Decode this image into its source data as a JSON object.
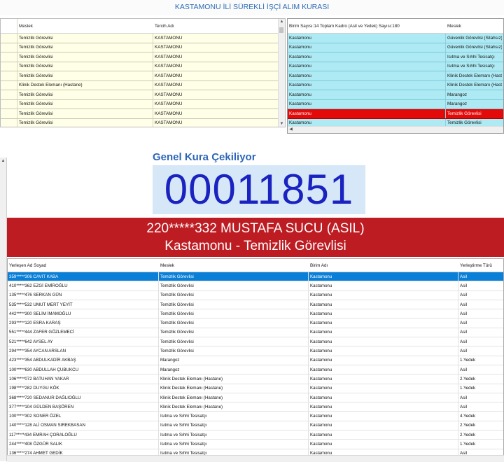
{
  "app": {
    "title": "KASTAMONU İLİ SÜREKLİ İŞÇİ ALIM KURASI"
  },
  "left_grid": {
    "columns": [
      "Meslek",
      "Tercih Adı"
    ],
    "rows": [
      [
        "Temizlik Görevlisi",
        "KASTAMONU"
      ],
      [
        "Temizlik Görevlisi",
        "KASTAMONU"
      ],
      [
        "Temizlik Görevlisi",
        "KASTAMONU"
      ],
      [
        "Temizlik Görevlisi",
        "KASTAMONU"
      ],
      [
        "Temizlik Görevlisi",
        "KASTAMONU"
      ],
      [
        "Klinik Destek Elemanı (Hastane)",
        "KASTAMONU"
      ],
      [
        "Temizlik Görevlisi",
        "KASTAMONU"
      ],
      [
        "Temizlik Görevlisi",
        "KASTAMONU"
      ],
      [
        "Temizlik Görevlisi",
        "KASTAMONU"
      ],
      [
        "Temizlik Görevlisi",
        "KASTAMONU"
      ]
    ]
  },
  "right_grid": {
    "columns": [
      "Birim Sayısı:14 Toplam Kadro (Asil ve Yedek) Sayısı:180",
      "Meslek"
    ],
    "rows": [
      {
        "cells": [
          "Kastamonu",
          "Güvenlik Görevlisi (Silahsız)"
        ],
        "highlight": false
      },
      {
        "cells": [
          "Kastamonu",
          "Güvenlik Görevlisi (Silahsız)"
        ],
        "highlight": false
      },
      {
        "cells": [
          "Kastamonu",
          "Isıtma ve Sıhhi Tesisatçı"
        ],
        "highlight": false
      },
      {
        "cells": [
          "Kastamonu",
          "Isıtma ve Sıhhi Tesisatçı"
        ],
        "highlight": false
      },
      {
        "cells": [
          "Kastamonu",
          "Klinik Destek Elemanı (Hastane)"
        ],
        "highlight": false
      },
      {
        "cells": [
          "Kastamonu",
          "Klinik Destek Elemanı (Hastane)"
        ],
        "highlight": false
      },
      {
        "cells": [
          "Kastamonu",
          "Marangoz"
        ],
        "highlight": false
      },
      {
        "cells": [
          "Kastamonu",
          "Marangoz"
        ],
        "highlight": false
      },
      {
        "cells": [
          "Kastamonu",
          "Temizlik Görevlisi"
        ],
        "highlight": true
      },
      {
        "cells": [
          "Kastamonu",
          "Temizlik Görevlisi"
        ],
        "highlight": false
      }
    ],
    "colors": {
      "row": "#aeeaf4",
      "highlight": "#e30a0a"
    }
  },
  "draw": {
    "heading": "Genel Kura Çekiliyor",
    "number": "00011851",
    "winner_name": "220*****332 MUSTAFA SUCU (ASIL)",
    "winner_detail": "Kastamonu - Temizlik Görevlisi"
  },
  "bottom_grid": {
    "columns": [
      "Yerleşen Ad Soyad",
      "Meslek",
      "Birim Adı",
      "Yerleştirme Türü"
    ],
    "rows": [
      [
        "359*****306 CAVIT KABA",
        "Temizlik Görevlisi",
        "Kastamonu",
        "Asil"
      ],
      [
        "410*****362 EZGİ EMİROĞLU",
        "Temizlik Görevlisi",
        "Kastamonu",
        "Asil"
      ],
      [
        "135*****476 SERKAN GÜN",
        "Temizlik Görevlisi",
        "Kastamonu",
        "Asil"
      ],
      [
        "535*****532 UMUT MERT YEYİT",
        "Temizlik Görevlisi",
        "Kastamonu",
        "Asil"
      ],
      [
        "442*****300 SELİM İMAMOĞLU",
        "Temizlik Görevlisi",
        "Kastamonu",
        "Asil"
      ],
      [
        "293*****120 ESRA KARAŞ",
        "Temizlik Görevlisi",
        "Kastamonu",
        "Asil"
      ],
      [
        "551*****444 ZAFER GÖZLEMECİ",
        "Temizlik Görevlisi",
        "Kastamonu",
        "Asil"
      ],
      [
        "521*****642 AYSEL AY",
        "Temizlik Görevlisi",
        "Kastamonu",
        "Asil"
      ],
      [
        "294*****354 AYCAN ARSLAN",
        "Temizlik Görevlisi",
        "Kastamonu",
        "Asil"
      ],
      [
        "423*****354 ABDULKADİR AKBAŞ",
        "Marangoz",
        "Kastamonu",
        "1.Yedek"
      ],
      [
        "100*****630 ABDULLAH ÇUBUKCU",
        "Marangoz",
        "Kastamonu",
        "Asil"
      ],
      [
        "106*****072 BATUHAN YAKAR",
        "Klinik Destek Elemanı (Hastane)",
        "Kastamonu",
        "2.Yedek"
      ],
      [
        "198*****282 DUYGU KÖK",
        "Klinik Destek Elemanı (Hastane)",
        "Kastamonu",
        "1.Yedek"
      ],
      [
        "368*****720 SEDANUR DAĞLIOĞLU",
        "Klinik Destek Elemanı (Hastane)",
        "Kastamonu",
        "Asil"
      ],
      [
        "377*****104 GÜLDEN BAŞÖREN",
        "Klinik Destek Elemanı (Hastane)",
        "Kastamonu",
        "Asil"
      ],
      [
        "100*****302 SONER ÖZEL",
        "Isıtma ve Sıhhi Tesisatçı",
        "Kastamonu",
        "4.Yedek"
      ],
      [
        "140*****128 ALİ OSMAN SIREKBASAN",
        "Isıtma ve Sıhhi Tesisatçı",
        "Kastamonu",
        "2.Yedek"
      ],
      [
        "117*****434 EMRAH ÇORALOĞLU",
        "Isıtma ve Sıhhi Tesisatçı",
        "Kastamonu",
        "2.Yedek"
      ],
      [
        "244*****408 ÖZGÜR SALIK",
        "Isıtma ve Sıhhi Tesisatçı",
        "Kastamonu",
        "1.Yedek"
      ],
      [
        "136*****274 AHMET GEDİK",
        "Isıtma ve Sıhhi Tesisatçı",
        "Kastamonu",
        "Asil"
      ]
    ],
    "selected_row": 0,
    "colors": {
      "selected": "#0a7fd8"
    }
  },
  "colors": {
    "banner": "#bd1c22",
    "number_text": "#1a22c0",
    "number_bg": "#d6e8f7",
    "heading": "#2d66b8",
    "title": "#2b6cb5"
  }
}
